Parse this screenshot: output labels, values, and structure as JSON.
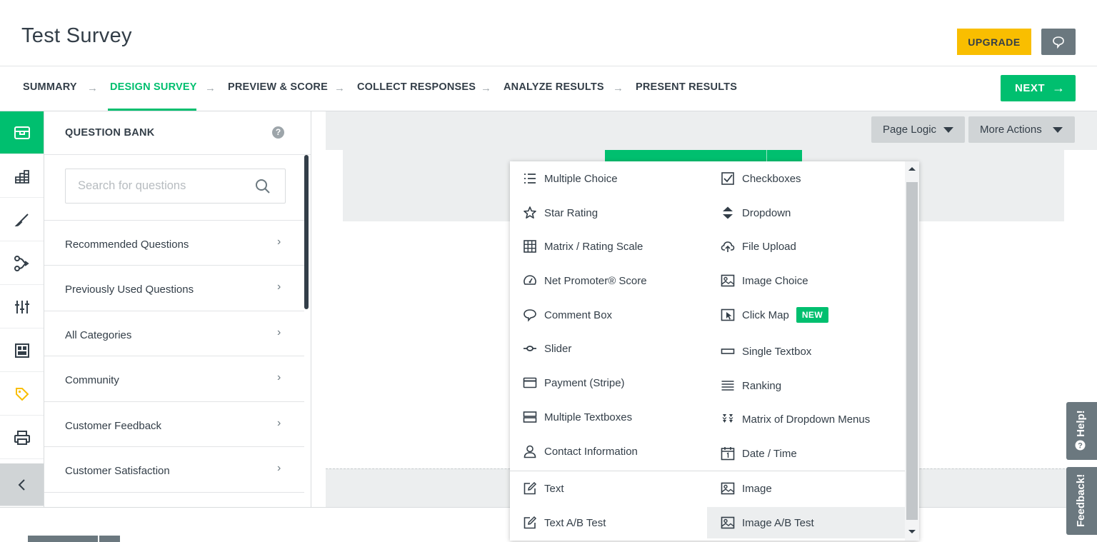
{
  "header": {
    "title": "Test Survey",
    "upgrade_label": "UPGRADE",
    "comment_icon": "speech-bubble-icon",
    "accent_color": "#00bf6f",
    "upgrade_color": "#f9be00"
  },
  "nav": {
    "items": [
      {
        "label": "SUMMARY",
        "active": false
      },
      {
        "label": "DESIGN SURVEY",
        "active": true
      },
      {
        "label": "PREVIEW & SCORE",
        "active": false
      },
      {
        "label": "COLLECT RESPONSES",
        "active": false
      },
      {
        "label": "ANALYZE RESULTS",
        "active": false
      },
      {
        "label": "PRESENT RESULTS",
        "active": false
      }
    ],
    "next_label": "NEXT"
  },
  "iconbar": {
    "items": [
      "builder-icon",
      "themes-icon",
      "design-brush-icon",
      "logic-icon",
      "options-icon",
      "layout-icon",
      "tags-icon",
      "print-icon"
    ],
    "collapse": "chevron-left-icon"
  },
  "question_bank": {
    "title": "QUESTION BANK",
    "help": "?",
    "search_placeholder": "Search for questions",
    "categories": [
      "Recommended Questions",
      "Previously Used Questions",
      "All Categories",
      "Community",
      "Customer Feedback",
      "Customer Satisfaction"
    ]
  },
  "toolbar": {
    "page_logic": "Page Logic",
    "more_actions": "More Actions"
  },
  "menu": {
    "left": [
      {
        "label": "Multiple Choice",
        "icon": "list-icon"
      },
      {
        "label": "Star Rating",
        "icon": "star-icon"
      },
      {
        "label": "Matrix / Rating Scale",
        "icon": "grid-icon"
      },
      {
        "label": "Net Promoter® Score",
        "icon": "gauge-icon"
      },
      {
        "label": "Comment Box",
        "icon": "comment-icon"
      },
      {
        "label": "Slider",
        "icon": "slider-icon"
      },
      {
        "label": "Payment (Stripe)",
        "icon": "card-icon"
      },
      {
        "label": "Multiple Textboxes",
        "icon": "textboxes-icon"
      },
      {
        "label": "Contact Information",
        "icon": "person-icon"
      }
    ],
    "right": [
      {
        "label": "Checkboxes",
        "icon": "checkbox-icon"
      },
      {
        "label": "Dropdown",
        "icon": "dropdown-icon"
      },
      {
        "label": "File Upload",
        "icon": "cloud-upload-icon"
      },
      {
        "label": "Image Choice",
        "icon": "image-icon"
      },
      {
        "label": "Click Map",
        "icon": "click-map-icon",
        "badge": "NEW"
      },
      {
        "label": "Single Textbox",
        "icon": "textbox-icon"
      },
      {
        "label": "Ranking",
        "icon": "ranking-icon"
      },
      {
        "label": "Matrix of Dropdown Menus",
        "icon": "matrix-dropdown-icon"
      },
      {
        "label": "Date / Time",
        "icon": "calendar-icon"
      }
    ],
    "static_left": [
      {
        "label": "Text",
        "icon": "edit-icon"
      },
      {
        "label": "Text A/B Test",
        "icon": "edit-icon"
      }
    ],
    "static_right": [
      {
        "label": "Image",
        "icon": "image-icon"
      },
      {
        "label": "Image A/B Test",
        "icon": "image-icon"
      }
    ]
  },
  "side_tabs": {
    "help": "Help!",
    "feedback": "Feedback!"
  }
}
